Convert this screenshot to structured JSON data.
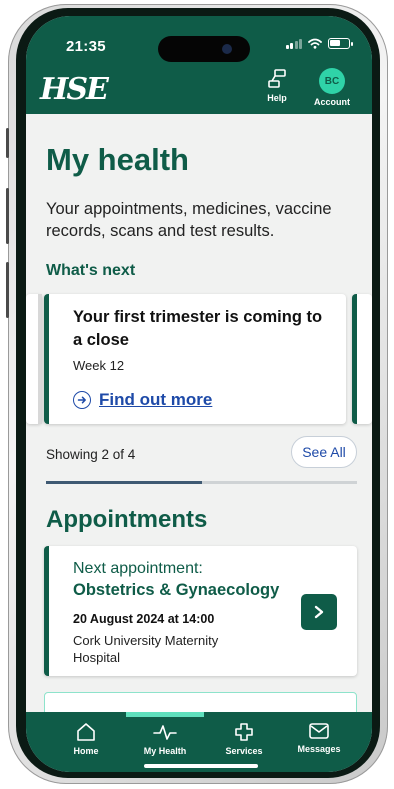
{
  "status_bar": {
    "time": "21:35"
  },
  "header": {
    "logo": "HSE",
    "help_label": "Help",
    "account_label": "Account",
    "account_initials": "BC"
  },
  "page": {
    "title": "My health",
    "intro": "Your appointments, medicines, vaccine records, scans and test results."
  },
  "whats_next": {
    "heading": "What's next",
    "card": {
      "title": "Your first trimester is coming to a close",
      "subtitle": "Week 12",
      "link": "Find out more"
    },
    "showing": "Showing 2 of 4",
    "see_all": "See All",
    "progress": 0.5
  },
  "appointments": {
    "heading": "Appointments",
    "card": {
      "label": "Next appointment:",
      "specialty": "Obstetrics & Gynaecology",
      "datetime": "20 August 2024 at 14:00",
      "location": "Cork University Maternity Hospital"
    }
  },
  "bottom_nav": {
    "items": [
      {
        "label": "Home",
        "icon": "home-icon"
      },
      {
        "label": "My Health",
        "icon": "pulse-icon"
      },
      {
        "label": "Services",
        "icon": "cross-icon"
      },
      {
        "label": "Messages",
        "icon": "envelope-icon"
      }
    ],
    "active_index": 1
  },
  "colors": {
    "brand": "#0f5c48",
    "accent": "#2fd3a8",
    "link": "#1e4aa8"
  }
}
